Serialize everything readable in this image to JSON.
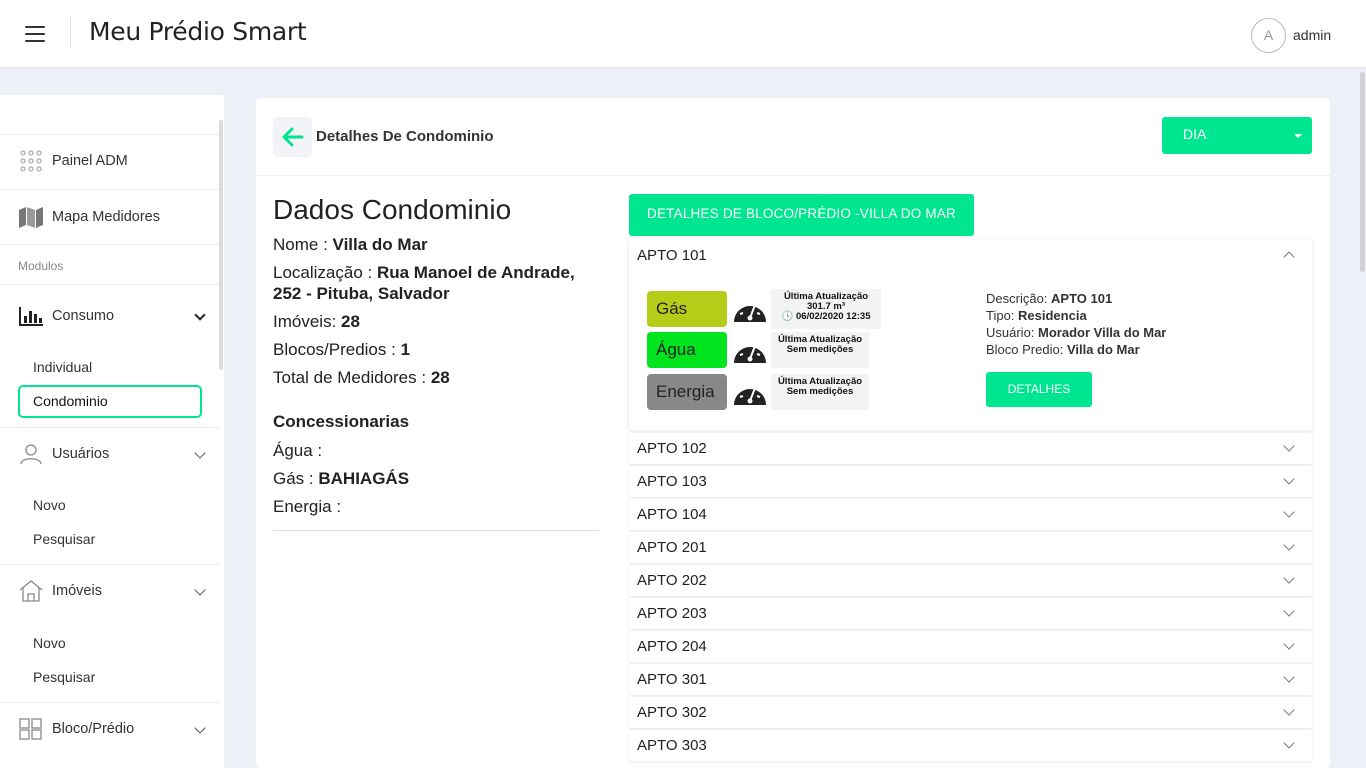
{
  "header": {
    "title": "Meu Prédio Smart",
    "avatar_initial": "A",
    "user": "admin"
  },
  "sidebar": {
    "painel": "Painel ADM",
    "mapa": "Mapa Medidores",
    "section": "Modulos",
    "consumo": "Consumo",
    "consumo_items": [
      "Individual",
      "Condominio"
    ],
    "usuarios": "Usuários",
    "usuarios_items": [
      "Novo",
      "Pesquisar"
    ],
    "imoveis": "Imóveis",
    "imoveis_items": [
      "Novo",
      "Pesquisar"
    ],
    "bloco": "Bloco/Prédio"
  },
  "card": {
    "title": "Detalhes De Condominio",
    "period": "DIA"
  },
  "info": {
    "title": "Dados Condominio",
    "nome_label": "Nome : ",
    "nome": "Villa do Mar",
    "loc_label": "Localização : ",
    "loc1": "Rua Manoel de Andrade,",
    "loc2": "252 - Pituba, Salvador",
    "imoveis_label": "Imóveis: ",
    "imoveis": "28",
    "blocos_label": "Blocos/Predios : ",
    "blocos": "1",
    "medidores_label": "Total de Medidores : ",
    "medidores": "28",
    "conc_title": "Concessionarias",
    "agua_label": "Água :",
    "gas_label": "Gás : ",
    "gas": "BAHIAGÁS",
    "energia_label": "Energia :"
  },
  "bloco_button": "DETALHES DE BLOCO/PRÉDIO -VILLA DO MAR",
  "open_apto": {
    "label": "APTO 101",
    "meters": [
      {
        "name": "Gás",
        "color": "#b5cc18",
        "upd1": "Última Atualização",
        "upd2": "301.7 m³",
        "upd3": "06/02/2020 12:35"
      },
      {
        "name": "Água",
        "color": "#00e51e",
        "upd1": "Última Atualização",
        "upd2": "Sem medições"
      },
      {
        "name": "Energia",
        "color": "#888888",
        "upd1": "Última Atualização",
        "upd2": "Sem medições"
      }
    ],
    "desc_label": "Descrição: ",
    "desc": "APTO 101",
    "tipo_label": "Tipo: ",
    "tipo": "Residencia",
    "usuario_label": "Usuário: ",
    "usuario": "Morador Villa do Mar",
    "bloco_label": "Bloco Predio: ",
    "bloco": "Villa do Mar",
    "details_button": "DETALHES"
  },
  "aptos": [
    "APTO 102",
    "APTO 103",
    "APTO 104",
    "APTO 201",
    "APTO 202",
    "APTO 203",
    "APTO 204",
    "APTO 301",
    "APTO 302",
    "APTO 303"
  ],
  "colors": {
    "accent": "#00e58f"
  }
}
